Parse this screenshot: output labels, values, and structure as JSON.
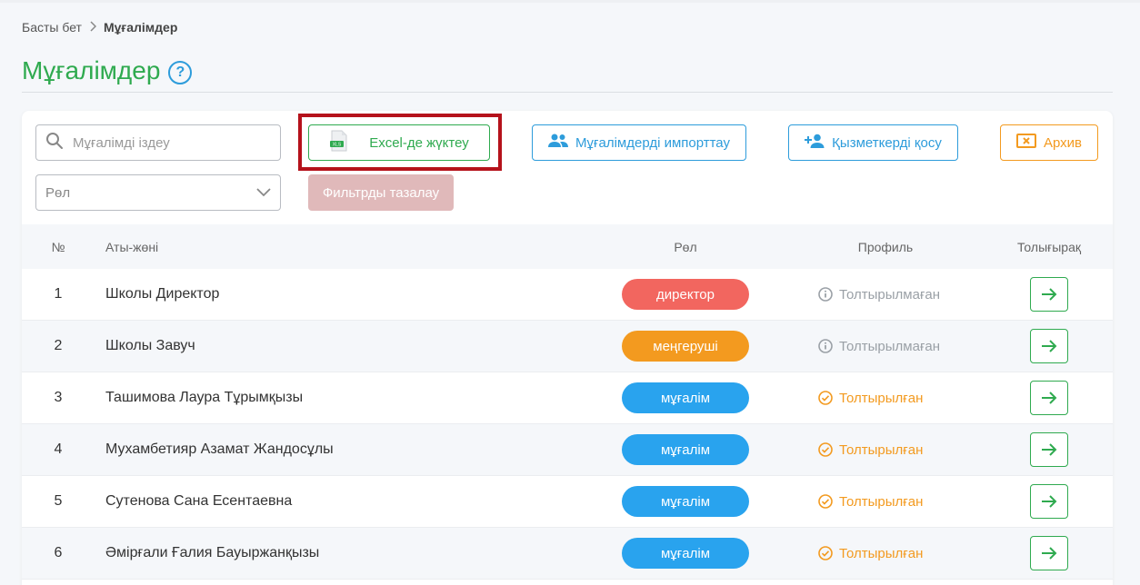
{
  "breadcrumb": {
    "home": "Басты бет",
    "current": "Мұғалімдер"
  },
  "page": {
    "title": "Мұғалімдер",
    "help_glyph": "?"
  },
  "toolbar": {
    "search_placeholder": "Мұғалімді іздеу",
    "role_placeholder": "Рөл",
    "excel_label": "Excel-де жүктеу",
    "import_label": "Мұғалімдерді импорттау",
    "add_staff_label": "Қызметкерді қосу",
    "archive_label": "Архив",
    "clear_filters_label": "Фильтрды тазалау"
  },
  "table": {
    "headers": {
      "no": "№",
      "name": "Аты-жөні",
      "role": "Рөл",
      "profile": "Профиль",
      "more": "Толығырақ"
    },
    "rows": [
      {
        "no": "1",
        "name": "Школы Директор",
        "role": "директор",
        "role_color": "#f2665f",
        "profile": "Толтырылмаған",
        "filled": false
      },
      {
        "no": "2",
        "name": "Школы Завуч",
        "role": "меңгеруші",
        "role_color": "#f39a1f",
        "profile": "Толтырылмаған",
        "filled": false
      },
      {
        "no": "3",
        "name": "Ташимова Лаура Тұрымқызы",
        "role": "мұғалім",
        "role_color": "#29a3ee",
        "profile": "Толтырылған",
        "filled": true
      },
      {
        "no": "4",
        "name": "Мухамбетияр Азамат Жандосұлы",
        "role": "мұғалім",
        "role_color": "#29a3ee",
        "profile": "Толтырылған",
        "filled": true
      },
      {
        "no": "5",
        "name": "Сутенова Сана Есентаевна",
        "role": "мұғалім",
        "role_color": "#29a3ee",
        "profile": "Толтырылған",
        "filled": true
      },
      {
        "no": "6",
        "name": "Әмірғали Ғалия Бауыржанқызы",
        "role": "мұғалім",
        "role_color": "#29a3ee",
        "profile": "Толтырылған",
        "filled": true
      }
    ]
  },
  "colors": {
    "accent_green": "#2faa4f",
    "accent_blue": "#2d9cdb",
    "accent_orange": "#f39a1f",
    "highlight_red": "#b5121b"
  }
}
